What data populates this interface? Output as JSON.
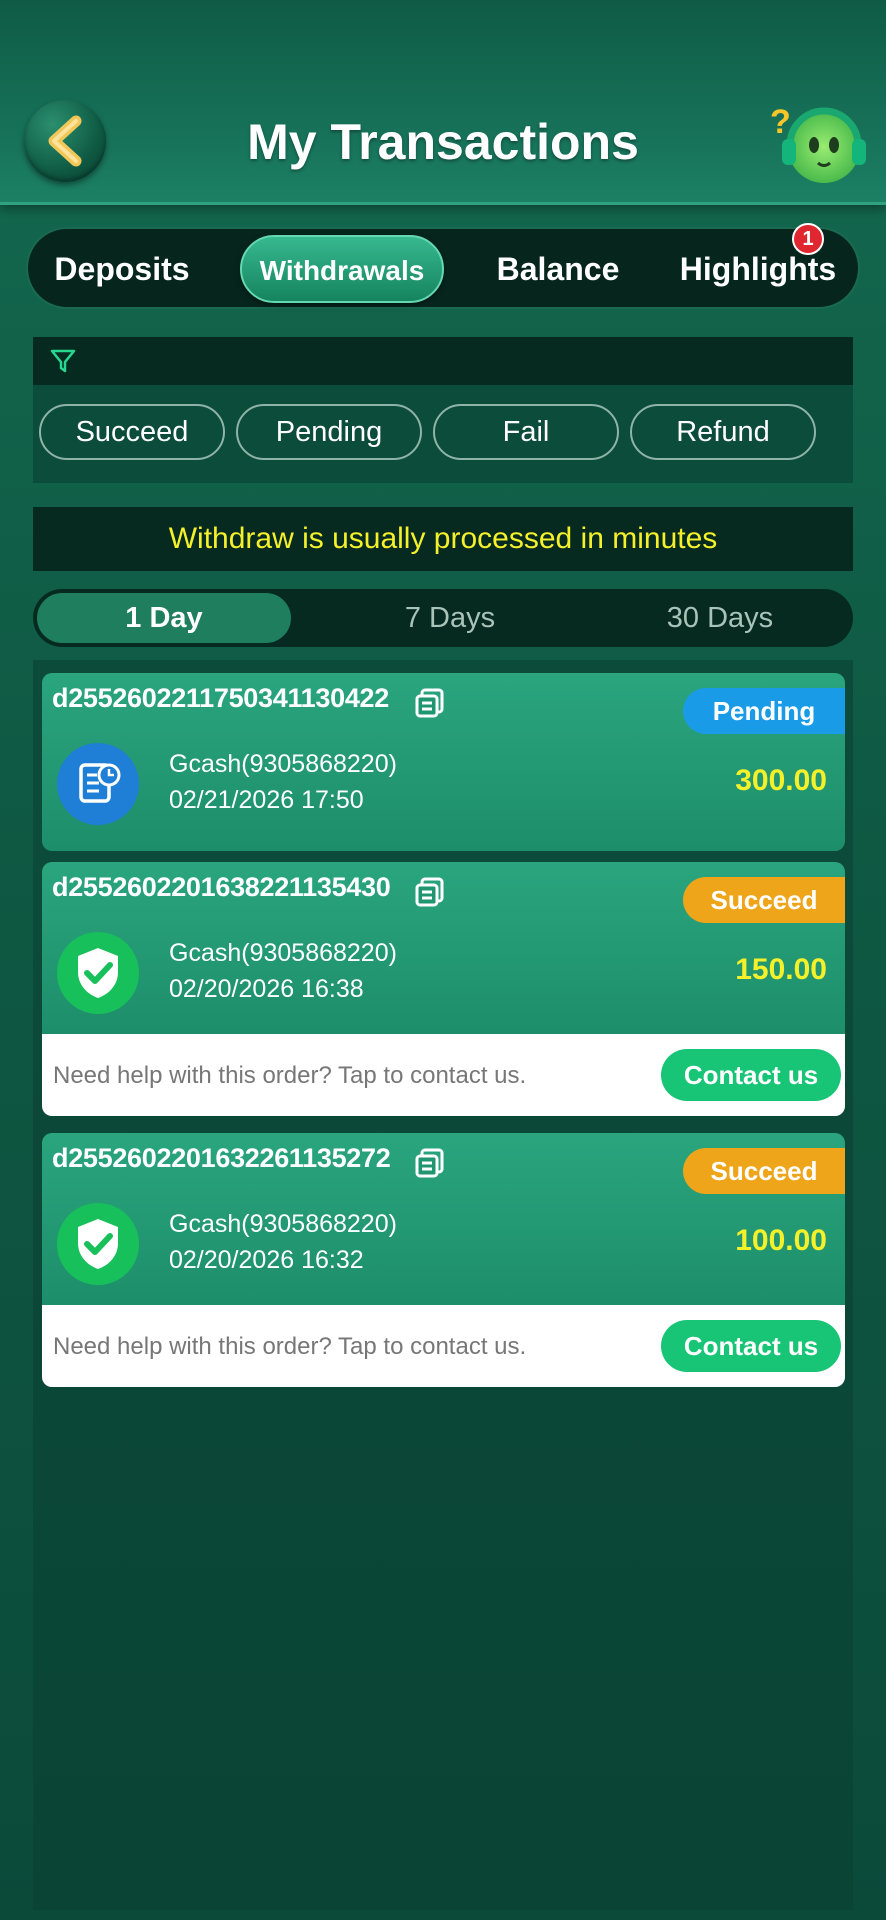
{
  "header": {
    "title": "My Transactions",
    "back_icon": "chevron-left-icon",
    "support_icon": "support-headset-icon"
  },
  "main_tabs": [
    {
      "label": "Deposits",
      "active": false
    },
    {
      "label": "Withdrawals",
      "active": true
    },
    {
      "label": "Balance",
      "active": false
    },
    {
      "label": "Highlights",
      "active": false,
      "badge": "1"
    }
  ],
  "filter": {
    "icon": "filter-icon",
    "chips": [
      "Succeed",
      "Pending",
      "Fail",
      "Refund"
    ]
  },
  "notice": "Withdraw is usually processed in minutes",
  "day_tabs": [
    {
      "label": "1 Day",
      "active": true
    },
    {
      "label": "7 Days",
      "active": false
    },
    {
      "label": "30 Days",
      "active": false
    }
  ],
  "transactions": [
    {
      "id": "d2552602211750341130422",
      "status": "Pending",
      "method": "Gcash(9305868220)",
      "date": "02/21/2026 17:50",
      "amount": "300.00"
    },
    {
      "id": "d2552602201638221135430",
      "status": "Succeed",
      "method": "Gcash(9305868220)",
      "date": "02/20/2026 16:38",
      "amount": "150.00",
      "help_text": "Need help with this order? Tap to contact us.",
      "contact_label": "Contact us"
    },
    {
      "id": "d2552602201632261135272",
      "status": "Succeed",
      "method": "Gcash(9305868220)",
      "date": "02/20/2026 16:32",
      "amount": "100.00",
      "help_text": "Need help with this order? Tap to contact us.",
      "contact_label": "Contact us"
    }
  ],
  "colors": {
    "accent_green": "#18c576",
    "pending_blue": "#1a9be8",
    "succeed_orange": "#eea51a",
    "amount_yellow": "#f4f02a",
    "notice_yellow": "#f4f02a"
  }
}
